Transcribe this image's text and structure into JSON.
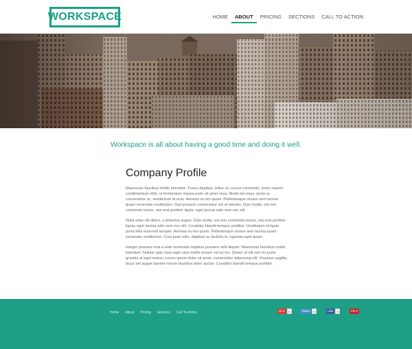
{
  "header": {
    "logo": "WORKSPACE",
    "nav": [
      "HOME",
      "ABOUT",
      "PRICING",
      "SECTIONS",
      "CALL TO ACTION"
    ],
    "active_nav": "ABOUT"
  },
  "tagline": "Workspace is all about having a good time and doing it well.",
  "main": {
    "title": "Company Profile",
    "paragraphs": [
      "Maecenas faucibus mollis interdum. Fusce dapibus, tellus ac cursus commodo, tortor mauris condimentum nibh, ut fermentum massa justo sit amet risus. Morbi leo risus, porta ac consectetur ac, vestibulum at eros. Aenean eu leo quam. Pellentesque ornare sem lacinia quam venenatis vestibulum. Sed posuere consectetur est at lobortis. Duis mollis, est non commodo luctus, nisi erat porttitor ligula, eget lacinia odio sem nec elit.",
      "Nulla vitae elit libero, a pharetra augue. Duis mollis, est non commodo luctus, nisi erat porttitor ligula, eget lacinia odio sem nec elit. Curabitur blandit tempus porttitor. Vestibulum id ligula porta felis euismod semper. Aenean eu leo quam. Pellentesque ornare sem lacinia quam venenatis vestibulum. Cras justo odio, dapibus ac facilisis in, egestas eget quam.",
      "Integer posuere erat a ante venenatis dapibus posuere velit aliquet. Maecenas faucibus mollis interdum. Nullam quis risus eget urna mollis ornare vel eu leo. Donec id elit non mi porta gravida at eget metus. Lorem ipsum dolor sit amet, consectetur adipiscing elit. Vivamus sagittis lacus vel augue laoreet rutrum faucibus dolor auctor. Curabitur blandit tempus porttitor."
    ]
  },
  "footer": {
    "nav": [
      "Home",
      "About",
      "Pricing",
      "Sections",
      "Call To Action"
    ],
    "social": [
      {
        "label": "G+1",
        "count": "0",
        "color": "#d44132"
      },
      {
        "label": "Tweet",
        "count": "0",
        "color": "#3d90c8"
      },
      {
        "label": "Like",
        "count": "0",
        "color": "#3b5998"
      },
      {
        "label": "Pin it",
        "count": "",
        "color": "#c8232c"
      }
    ]
  },
  "colors": {
    "accent": "#1aa085",
    "footer_bg": "#1e9f86"
  }
}
